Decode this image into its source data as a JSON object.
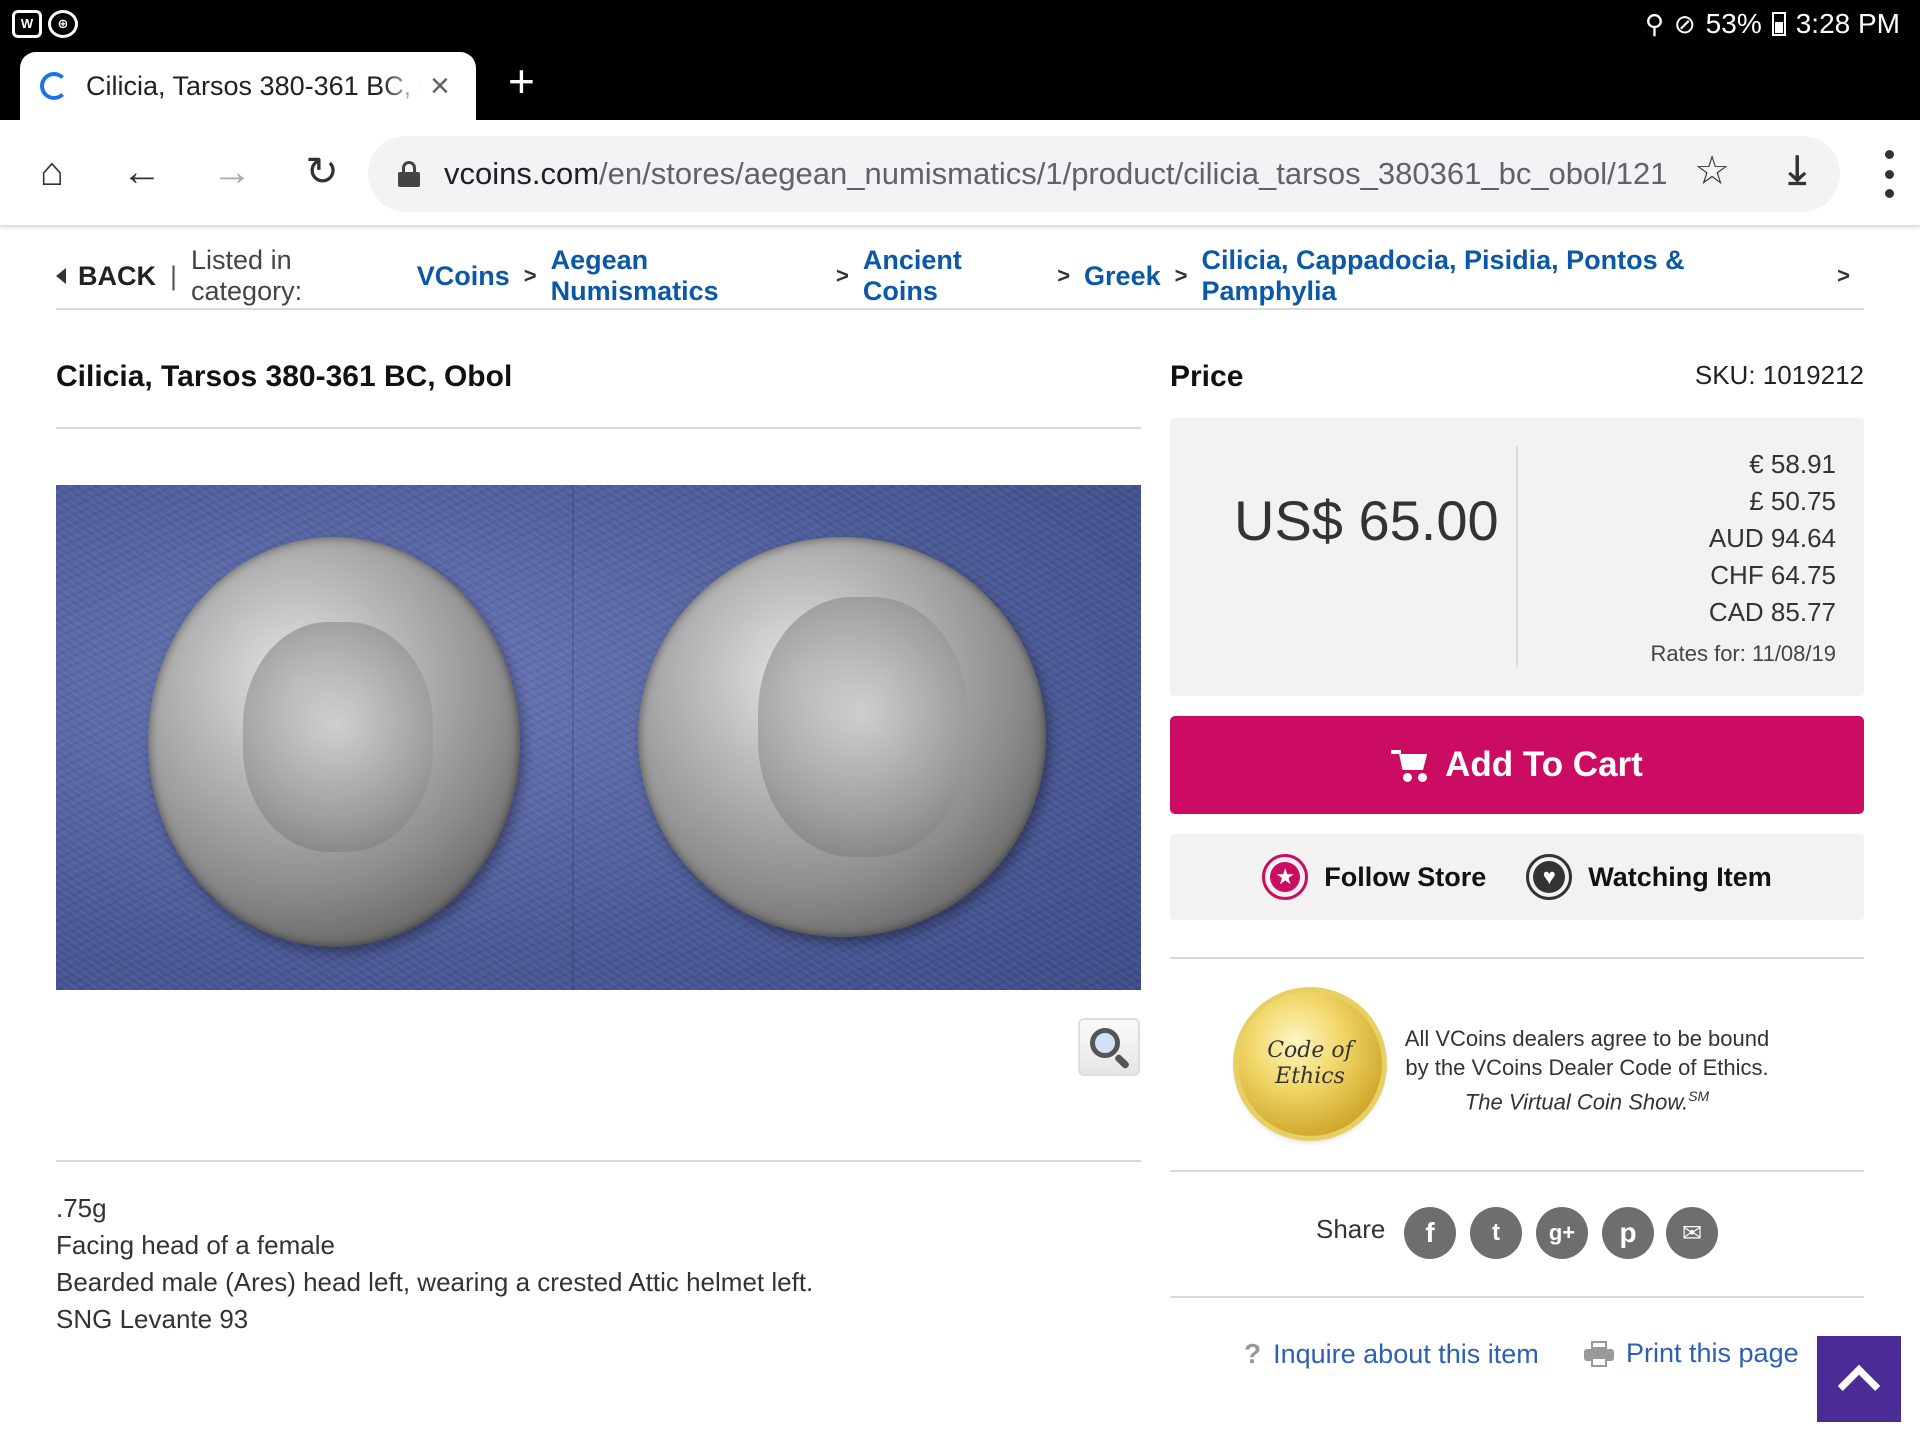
{
  "status_bar": {
    "left_icons": [
      "app-icon-1",
      "app-icon-2"
    ],
    "battery": "53%",
    "time": "3:28 PM"
  },
  "tab": {
    "title": "Cilicia, Tarsos 380-361 BC, O",
    "close": "×",
    "new_tab": "+"
  },
  "toolbar": {
    "url_host": "vcoins.com",
    "url_path": "/en/stores/aegean_numismatics/1/product/cilicia_tarsos_380361_bc_obol/121"
  },
  "breadcrumb": {
    "back": "BACK",
    "separator": "|",
    "label": "Listed in category:",
    "items": [
      "VCoins",
      "Aegean Numismatics",
      "Ancient Coins",
      "Greek",
      "Cilicia, Cappadocia, Pisidia, Pontos & Pamphylia"
    ],
    "arrow": ">"
  },
  "product": {
    "title": "Cilicia, Tarsos 380-361 BC, Obol",
    "description": [
      ".75g",
      "Facing head of a female",
      "Bearded male (Ares) head left, wearing a crested Attic helmet left.",
      "SNG Levante 93"
    ]
  },
  "price": {
    "heading": "Price",
    "sku": "SKU: 1019212",
    "main": "US$ 65.00",
    "conversions": [
      "€ 58.91",
      "£ 50.75",
      "AUD 94.64",
      "CHF 64.75",
      "CAD 85.77"
    ],
    "rates_date": "Rates for: 11/08/19"
  },
  "actions": {
    "add_to_cart": "Add To Cart",
    "follow_store": "Follow Store",
    "watching_item": "Watching Item",
    "inquire": "Inquire about this item",
    "print": "Print this page"
  },
  "ethics": {
    "seal_line1": "Code of",
    "seal_line2": "Ethics",
    "line1": "All VCoins dealers agree to be bound",
    "line2": "by the VCoins Dealer Code of Ethics.",
    "line3": "The Virtual Coin Show.",
    "mark": "SM"
  },
  "share": {
    "label": "Share",
    "icons": [
      "f",
      "t",
      "g+",
      "p",
      "✉"
    ]
  },
  "colors": {
    "accent": "#cc0b62",
    "link": "#0b57a8",
    "scroll_top": "#4b2b96"
  }
}
